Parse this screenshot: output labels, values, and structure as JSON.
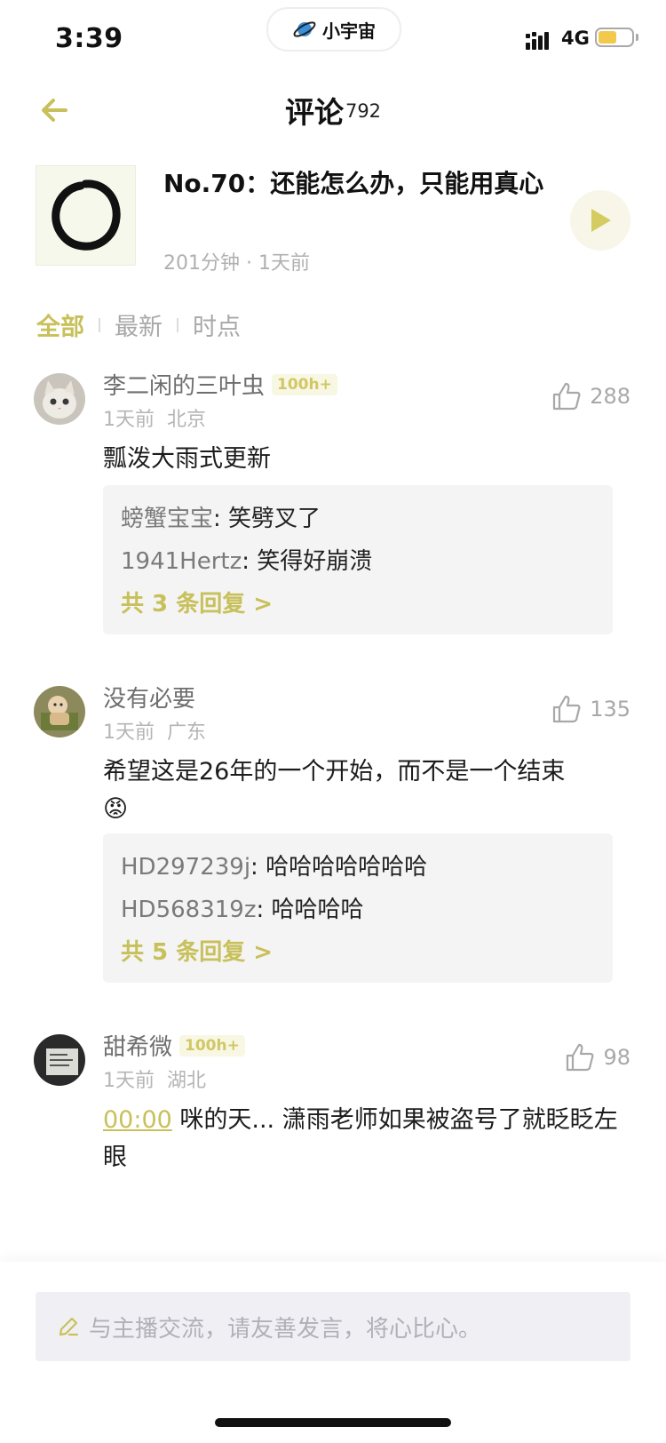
{
  "status_bar": {
    "time": "3:39",
    "network": "4G",
    "battery_level": 0.55,
    "app_pill": {
      "label": "小宇宙",
      "icon": "planet-icon"
    }
  },
  "header": {
    "back_icon": "arrow-left-icon",
    "title": "评论",
    "count": "792"
  },
  "episode": {
    "title": "No.70：还能怎么办，只能用真心",
    "meta": "201分钟 · 1天前",
    "play_icon": "play-icon"
  },
  "tabs": [
    {
      "label": "全部",
      "active": true
    },
    {
      "label": "最新",
      "active": false
    },
    {
      "label": "时点",
      "active": false
    }
  ],
  "comments": [
    {
      "username": "李二闲的三叶虫",
      "badge": "100h+",
      "time": "1天前",
      "location": "北京",
      "likes": "288",
      "text": "瓢泼大雨式更新",
      "replies": [
        {
          "who": "螃蟹宝宝",
          "text": ": 笑劈叉了"
        },
        {
          "who": "1941Hertz",
          "text": ": 笑得好崩溃"
        }
      ],
      "more": "共 3 条回复 >"
    },
    {
      "username": "没有必要",
      "time": "1天前",
      "location": "广东",
      "likes": "135",
      "text": "希望这是26年的一个开始，而不是一个结束",
      "emoji": "😡",
      "replies": [
        {
          "who": "HD297239j",
          "text": ": 哈哈哈哈哈哈哈"
        },
        {
          "who": "HD568319z",
          "text": ": 哈哈哈哈"
        }
      ],
      "more": "共 5 条回复 >"
    },
    {
      "username": "甜希微",
      "badge": "100h+",
      "time": "1天前",
      "location": "湖北",
      "likes": "98",
      "timestamp": "00:00",
      "text": " 咪的天... 潇雨老师如果被盗号了就眨眨左眼"
    }
  ],
  "composer": {
    "placeholder": "与主播交流，请友善发言，将心比心。",
    "icon": "pencil-icon"
  },
  "colors": {
    "accent": "#c8c05a",
    "muted": "#a8a8a8",
    "reply_bg": "#f4f4f4"
  }
}
